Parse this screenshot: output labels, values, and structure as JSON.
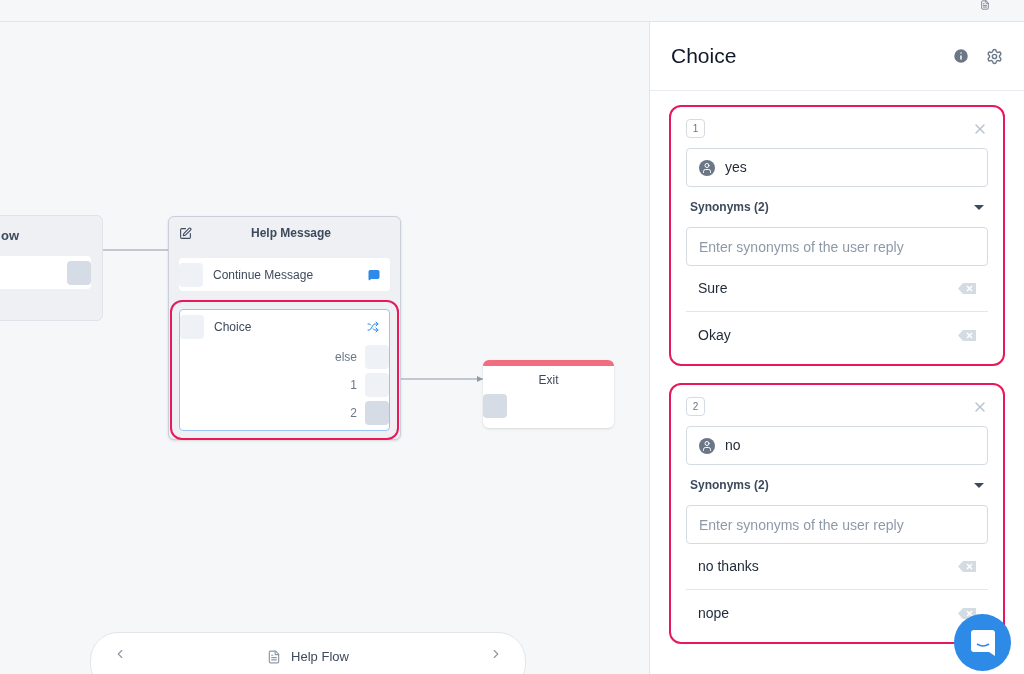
{
  "canvas": {
    "nodes": [
      {
        "kind": "partial",
        "title": "ow"
      },
      {
        "kind": "message",
        "title": "Help Message",
        "rows": [
          {
            "kind": "text",
            "label": "Continue Message",
            "highlighted": false
          },
          {
            "kind": "choice",
            "label": "Choice",
            "highlighted": true,
            "outputs": [
              {
                "label": "else",
                "connected": false
              },
              {
                "label": "1",
                "connected": false
              },
              {
                "label": "2",
                "connected": true
              }
            ]
          }
        ]
      },
      {
        "kind": "exit",
        "title": "Exit"
      }
    ],
    "flow_pill": {
      "title": "Help Flow"
    }
  },
  "panel": {
    "title": "Choice",
    "choices": [
      {
        "number": "1",
        "highlighted": true,
        "reply": "yes",
        "synonyms_label": "Synonyms (2)",
        "expanded": true,
        "placeholder": "Enter synonyms of the user reply",
        "synonyms": [
          "Sure",
          "Okay"
        ]
      },
      {
        "number": "2",
        "highlighted": true,
        "reply": "no",
        "synonyms_label": "Synonyms (2)",
        "expanded": true,
        "placeholder": "Enter synonyms of the user reply",
        "synonyms": [
          "no thanks",
          "nope"
        ]
      }
    ]
  }
}
